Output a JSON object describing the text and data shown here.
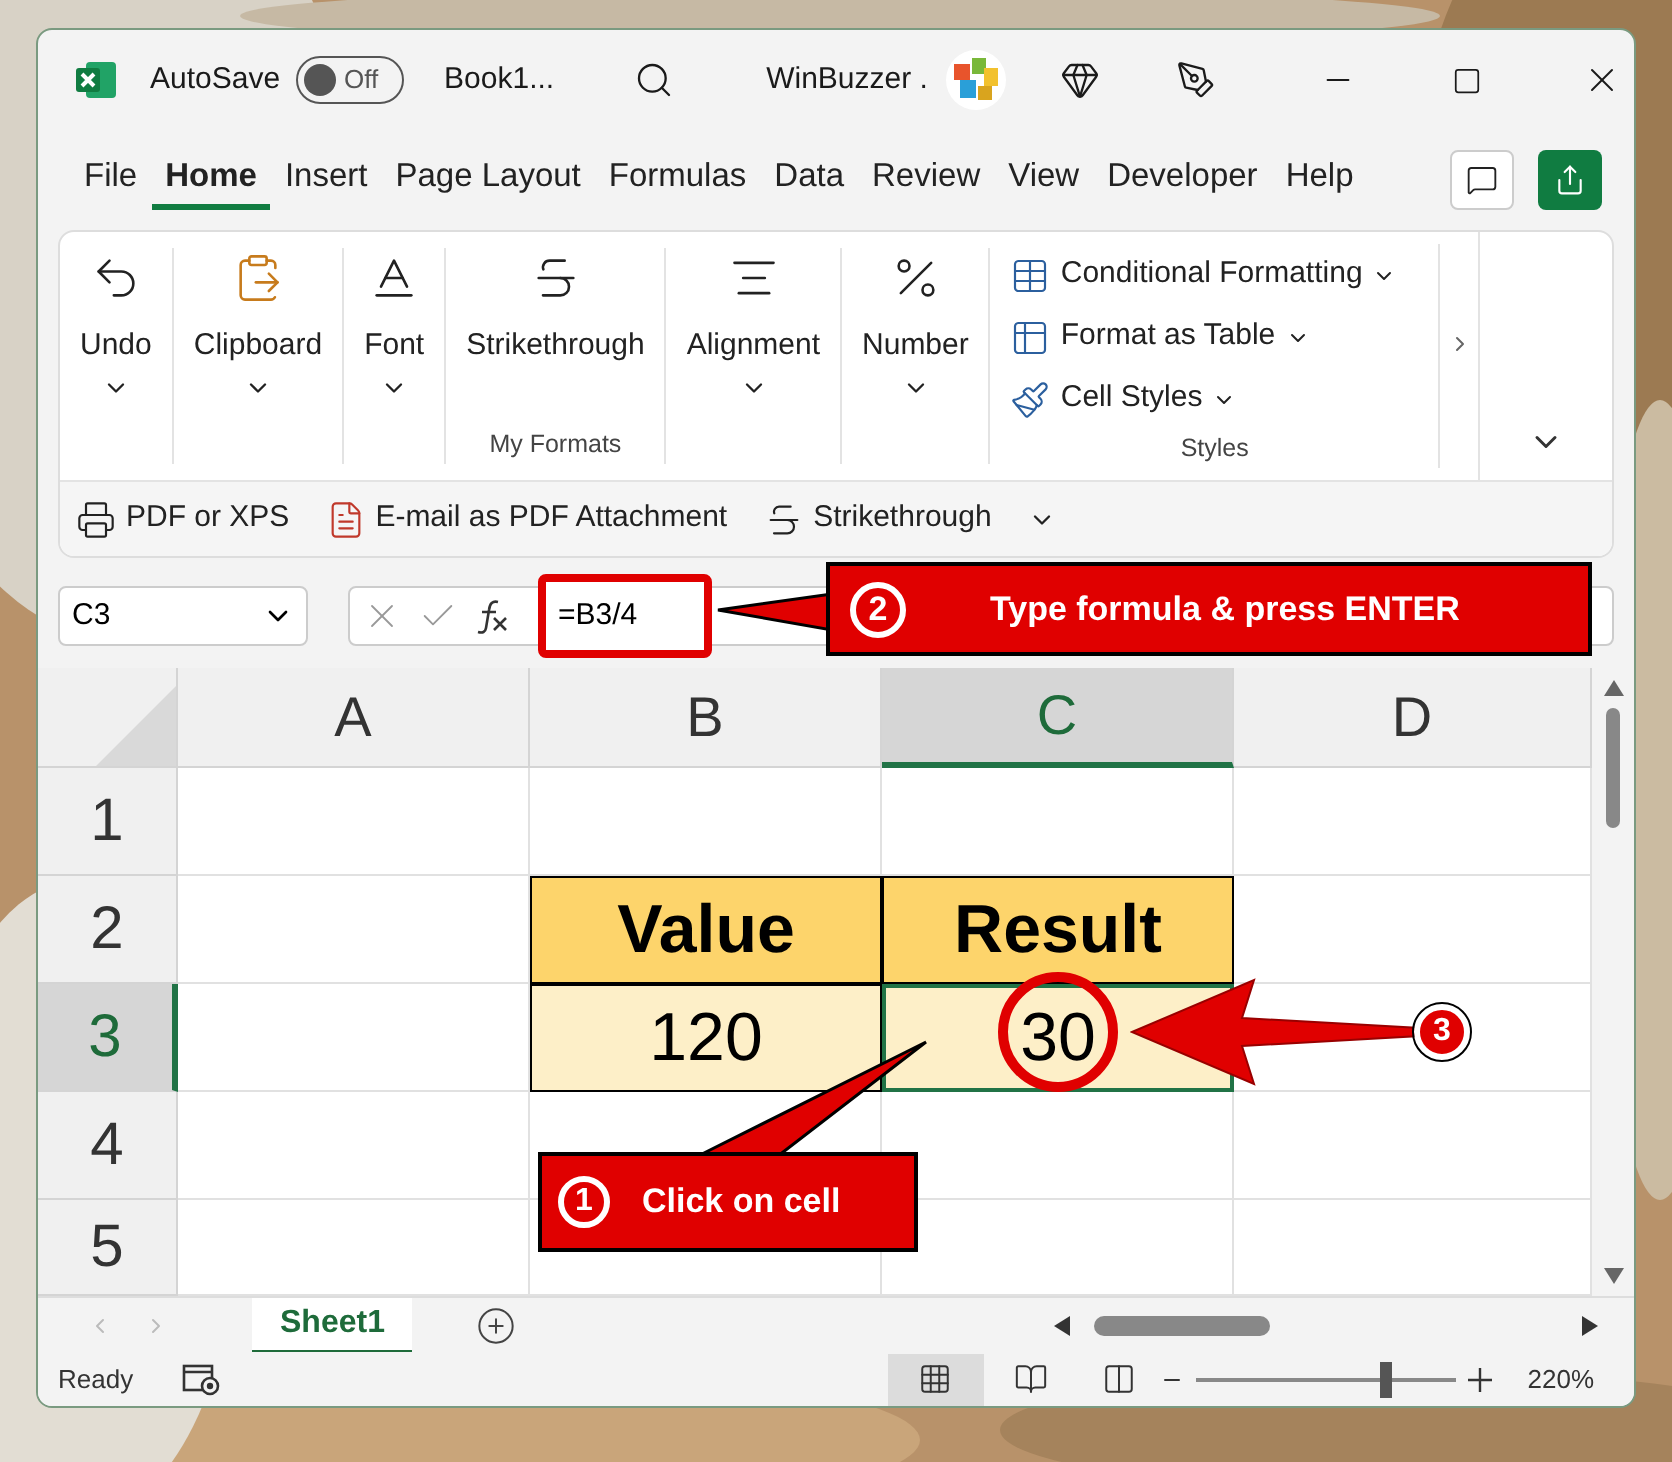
{
  "title_bar": {
    "autosave": {
      "label": "AutoSave",
      "state_label": "Off",
      "on": false
    },
    "document": "Book1...",
    "account": "WinBuzzer ."
  },
  "menu_tabs": [
    {
      "label": "File",
      "selected": false
    },
    {
      "label": "Home",
      "selected": true
    },
    {
      "label": "Insert",
      "selected": false
    },
    {
      "label": "Page Layout",
      "selected": false
    },
    {
      "label": "Formulas",
      "selected": false
    },
    {
      "label": "Data",
      "selected": false
    },
    {
      "label": "Review",
      "selected": false
    },
    {
      "label": "View",
      "selected": false
    },
    {
      "label": "Developer",
      "selected": false
    },
    {
      "label": "Help",
      "selected": false
    }
  ],
  "ribbon": {
    "buttons": [
      {
        "label": "Undo",
        "dropdown": true
      },
      {
        "label": "Clipboard",
        "dropdown": true
      },
      {
        "label": "Font",
        "dropdown": true
      },
      {
        "label": "Strikethrough",
        "dropdown": false,
        "group": "My Formats"
      },
      {
        "label": "Alignment",
        "dropdown": true
      },
      {
        "label": "Number",
        "dropdown": true
      }
    ],
    "styles": {
      "group": "Styles",
      "items": [
        {
          "label": "Conditional Formatting",
          "dropdown": true
        },
        {
          "label": "Format as Table",
          "dropdown": true
        },
        {
          "label": "Cell Styles",
          "dropdown": true
        }
      ]
    }
  },
  "quick_access": [
    "PDF or XPS",
    "E-mail as PDF Attachment",
    "Strikethrough"
  ],
  "formula_bar": {
    "name_box": "C3",
    "formula": "=B3/4"
  },
  "columns": [
    {
      "label": "A",
      "selected": false
    },
    {
      "label": "B",
      "selected": false
    },
    {
      "label": "C",
      "selected": true
    },
    {
      "label": "D",
      "selected": false
    }
  ],
  "rows": [
    {
      "label": "1",
      "selected": false,
      "cells": [
        {
          "kind": "blank",
          "selected": false
        },
        {
          "kind": "blank",
          "selected": false
        },
        {
          "kind": "blank",
          "selected": false
        },
        {
          "kind": "blank",
          "selected": false
        }
      ]
    },
    {
      "label": "2",
      "selected": false,
      "cells": [
        {
          "kind": "blank",
          "selected": false
        },
        {
          "kind": "heading",
          "text": "Value",
          "color": "#fdd46b",
          "selected": false
        },
        {
          "kind": "heading",
          "text": "Result",
          "color": "#fdd46b",
          "selected": false
        },
        {
          "kind": "blank",
          "selected": false
        }
      ]
    },
    {
      "label": "3",
      "selected": true,
      "cells": [
        {
          "kind": "blank",
          "selected": false
        },
        {
          "kind": "value",
          "text": "120",
          "color": "#fdefc8",
          "selected": false
        },
        {
          "kind": "value",
          "text": "30",
          "color": "#fdefc8",
          "selected": true
        },
        {
          "kind": "blank",
          "selected": false
        }
      ]
    },
    {
      "label": "4",
      "selected": false,
      "cells": [
        {
          "kind": "blank",
          "selected": false
        },
        {
          "kind": "blank",
          "selected": false
        },
        {
          "kind": "blank",
          "selected": false
        },
        {
          "kind": "blank",
          "selected": false
        }
      ]
    },
    {
      "label": "5",
      "selected": false,
      "cells": [
        {
          "kind": "blank",
          "selected": false
        },
        {
          "kind": "blank",
          "selected": false
        },
        {
          "kind": "blank",
          "selected": false
        },
        {
          "kind": "blank",
          "selected": false
        }
      ]
    }
  ],
  "sheet_tabs": [
    {
      "label": "Sheet1",
      "selected": true
    }
  ],
  "status_bar": {
    "status": "Ready",
    "zoom": "220%",
    "zoom_level": {
      "level": 0.73
    }
  },
  "annotations": [
    {
      "kind": "callout",
      "badge": "2",
      "text": "Type formula & press ENTER"
    },
    {
      "kind": "callout",
      "badge": "1",
      "text": "Click on cell"
    },
    {
      "kind": "arrow",
      "badge": "3"
    }
  ]
}
